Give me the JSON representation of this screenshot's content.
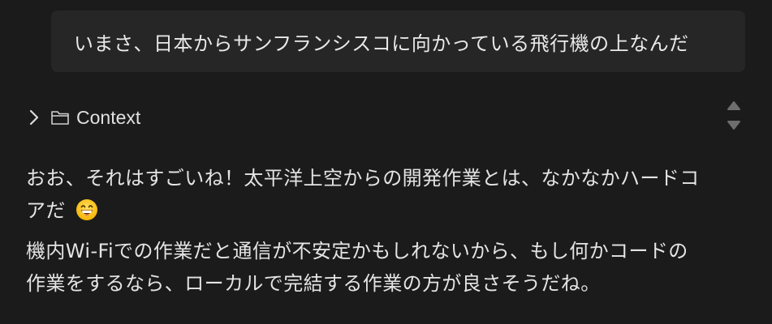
{
  "user_message": {
    "text": "いまさ、日本からサンフランシスコに向かっている飛行機の上なんだ"
  },
  "context_section": {
    "label": "Context",
    "collapsed": true,
    "icons": [
      "chevron-right-icon",
      "folder-icon"
    ]
  },
  "scroll_control": {
    "icons": [
      "arrow-up-icon",
      "arrow-down-icon"
    ]
  },
  "assistant_message": {
    "paragraph1_line1": "おお、それはすごいね！太平洋上空からの開発作業とは、なかなかハードコ",
    "paragraph1_line2": "アだ",
    "emoji": "grinning-face-with-smiling-eyes",
    "paragraph2_line1": "機内Wi-Fiでの作業だと通信が不安定かもしれないから、もし何かコードの",
    "paragraph2_line2": "作業をするなら、ローカルで完結する作業の方が良さそうだね。"
  },
  "colors": {
    "background": "#1b1b1b",
    "bubble": "#262626",
    "text": "#e4e4e4",
    "muted_icon": "#6e6e6e"
  }
}
